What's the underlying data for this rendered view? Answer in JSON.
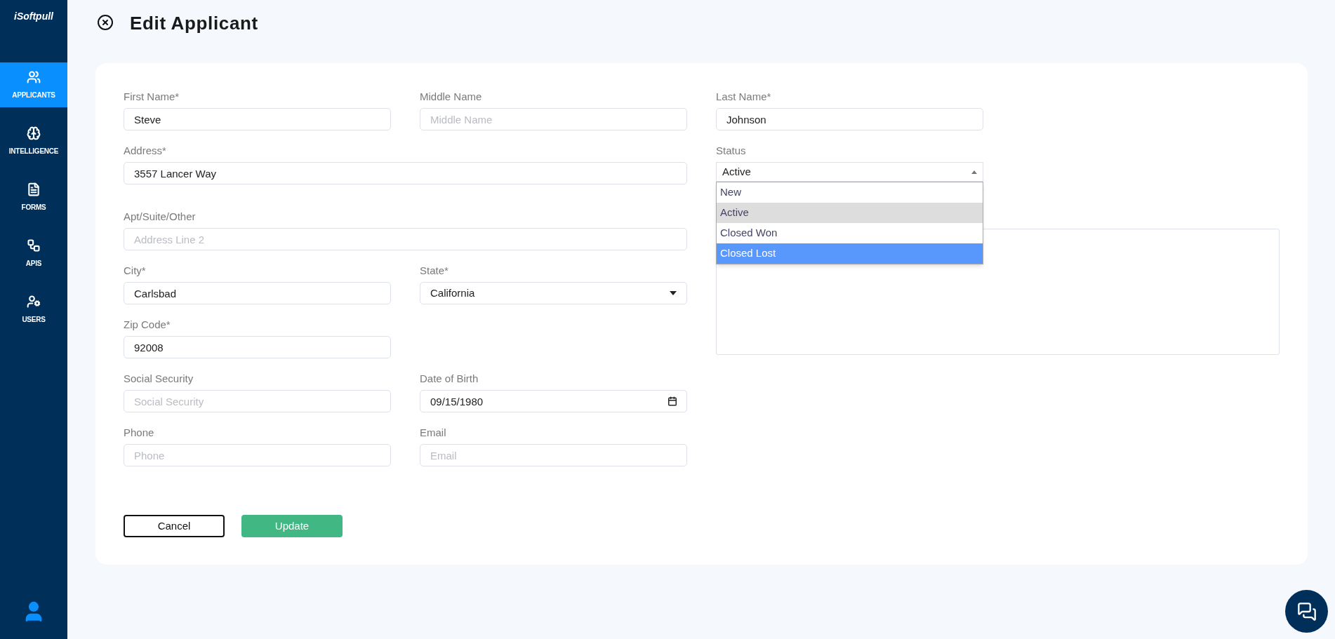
{
  "sidebar": {
    "logo": "iSoftpull",
    "items": [
      {
        "label": "APPLICANTS",
        "kind": "applicants",
        "selected": true
      },
      {
        "label": "INTELLIGENCE",
        "kind": "intelligence",
        "selected": false
      },
      {
        "label": "FORMS",
        "kind": "forms",
        "selected": false
      },
      {
        "label": "APIS",
        "kind": "apis",
        "selected": false
      },
      {
        "label": "USERS",
        "kind": "users",
        "selected": false
      }
    ]
  },
  "header": {
    "title": "Edit Applicant"
  },
  "form": {
    "rows": [
      [
        {
          "label": "First Name*",
          "kind": "text",
          "value": "Steve"
        },
        {
          "label": "Middle Name",
          "kind": "text",
          "placeholder": "Middle Name"
        }
      ],
      [
        {
          "label": "Address*",
          "kind": "text",
          "value": "3557 Lancer Way"
        }
      ],
      [
        {
          "label": "Apt/Suite/Other",
          "kind": "text",
          "placeholder": "Address Line 2"
        }
      ],
      [
        {
          "label": "City*",
          "kind": "text",
          "value": "Carlsbad"
        },
        {
          "label": "State*",
          "kind": "select",
          "value": "California"
        }
      ],
      [
        {
          "label": "Zip Code*",
          "kind": "text",
          "value": "92008"
        }
      ],
      [
        {
          "label": "Social Security",
          "kind": "text",
          "placeholder": "Social Security"
        },
        {
          "label": "Date of Birth",
          "kind": "date",
          "value": "09/15/1980"
        }
      ],
      [
        {
          "label": "Phone",
          "kind": "text",
          "placeholder": "Phone"
        },
        {
          "label": "Email",
          "kind": "text",
          "placeholder": "Email"
        }
      ]
    ],
    "last_name": {
      "label": "Last Name*",
      "value": "Johnson"
    },
    "status": {
      "label": "Status",
      "value": "Active",
      "expanded": true,
      "options": [
        {
          "label": "New",
          "selected": false,
          "highlighted": false
        },
        {
          "label": "Active",
          "selected": true,
          "highlighted": false
        },
        {
          "label": "Closed Won",
          "selected": false,
          "highlighted": false
        },
        {
          "label": "Closed Lost",
          "selected": false,
          "highlighted": true
        }
      ]
    },
    "buttons": [
      {
        "label": "Cancel",
        "kind": "outline"
      },
      {
        "label": "Update",
        "kind": "primary"
      }
    ]
  }
}
